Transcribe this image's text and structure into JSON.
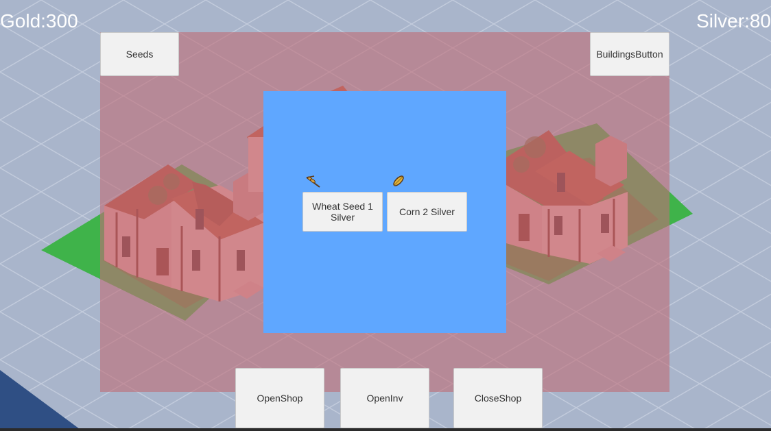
{
  "hud": {
    "gold_text": "Gold:300",
    "silver_text": "Silver:80"
  },
  "top_buttons": {
    "seeds_label": "Seeds",
    "buildings_label": "BuildingsButton"
  },
  "shop": {
    "items": [
      {
        "label": "Wheat Seed 1 Silver",
        "icon": "wheat-icon"
      },
      {
        "label": "Corn 2 Silver",
        "icon": "corn-icon"
      }
    ]
  },
  "bottom_buttons": {
    "open_shop_label": "OpenShop",
    "open_inv_label": "OpenInv",
    "close_shop_label": "CloseShop"
  },
  "colors": {
    "shop_panel": "#be6e78",
    "seeds_panel": "#5fa7ff",
    "button_bg": "#f1f1f1",
    "hud_text": "#ffffff",
    "grass": "#3fa63a",
    "background": "#a7b3c9"
  }
}
